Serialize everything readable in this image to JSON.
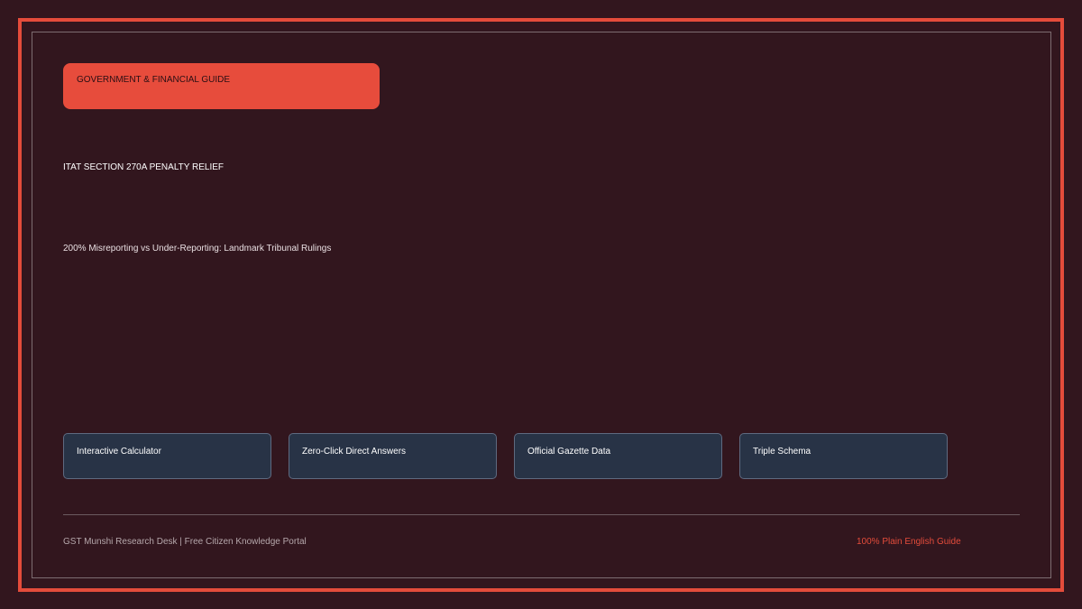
{
  "header": {
    "category_badge": "GOVERNMENT & FINANCIAL GUIDE",
    "section_title": "ITAT SECTION 270A PENALTY RELIEF",
    "subtitle": "200% Misreporting vs Under-Reporting: Landmark Tribunal Rulings"
  },
  "features": [
    {
      "label": "Interactive Calculator"
    },
    {
      "label": "Zero-Click Direct Answers"
    },
    {
      "label": "Official Gazette Data"
    },
    {
      "label": "Triple Schema"
    }
  ],
  "footer": {
    "left_text": "GST Munshi Research Desk | Free Citizen Knowledge Portal",
    "right_text": "100% Plain English Guide"
  },
  "colors": {
    "background": "#32161e",
    "accent": "#e74c3c",
    "card": "#283346"
  }
}
